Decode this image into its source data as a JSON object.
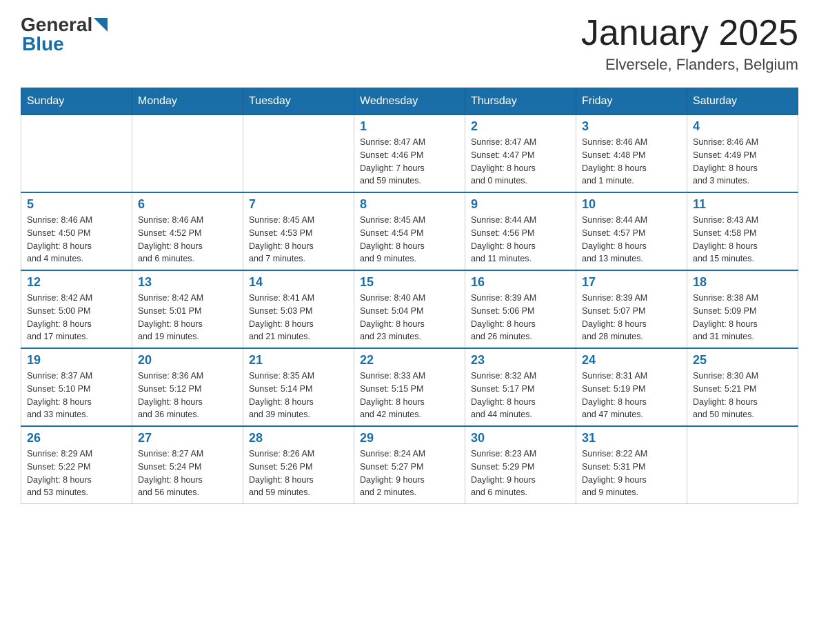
{
  "header": {
    "logo_general": "General",
    "logo_blue": "Blue",
    "month_title": "January 2025",
    "location": "Elversele, Flanders, Belgium"
  },
  "days_of_week": [
    "Sunday",
    "Monday",
    "Tuesday",
    "Wednesday",
    "Thursday",
    "Friday",
    "Saturday"
  ],
  "weeks": [
    {
      "days": [
        {
          "date": "",
          "info": ""
        },
        {
          "date": "",
          "info": ""
        },
        {
          "date": "",
          "info": ""
        },
        {
          "date": "1",
          "info": "Sunrise: 8:47 AM\nSunset: 4:46 PM\nDaylight: 7 hours\nand 59 minutes."
        },
        {
          "date": "2",
          "info": "Sunrise: 8:47 AM\nSunset: 4:47 PM\nDaylight: 8 hours\nand 0 minutes."
        },
        {
          "date": "3",
          "info": "Sunrise: 8:46 AM\nSunset: 4:48 PM\nDaylight: 8 hours\nand 1 minute."
        },
        {
          "date": "4",
          "info": "Sunrise: 8:46 AM\nSunset: 4:49 PM\nDaylight: 8 hours\nand 3 minutes."
        }
      ]
    },
    {
      "days": [
        {
          "date": "5",
          "info": "Sunrise: 8:46 AM\nSunset: 4:50 PM\nDaylight: 8 hours\nand 4 minutes."
        },
        {
          "date": "6",
          "info": "Sunrise: 8:46 AM\nSunset: 4:52 PM\nDaylight: 8 hours\nand 6 minutes."
        },
        {
          "date": "7",
          "info": "Sunrise: 8:45 AM\nSunset: 4:53 PM\nDaylight: 8 hours\nand 7 minutes."
        },
        {
          "date": "8",
          "info": "Sunrise: 8:45 AM\nSunset: 4:54 PM\nDaylight: 8 hours\nand 9 minutes."
        },
        {
          "date": "9",
          "info": "Sunrise: 8:44 AM\nSunset: 4:56 PM\nDaylight: 8 hours\nand 11 minutes."
        },
        {
          "date": "10",
          "info": "Sunrise: 8:44 AM\nSunset: 4:57 PM\nDaylight: 8 hours\nand 13 minutes."
        },
        {
          "date": "11",
          "info": "Sunrise: 8:43 AM\nSunset: 4:58 PM\nDaylight: 8 hours\nand 15 minutes."
        }
      ]
    },
    {
      "days": [
        {
          "date": "12",
          "info": "Sunrise: 8:42 AM\nSunset: 5:00 PM\nDaylight: 8 hours\nand 17 minutes."
        },
        {
          "date": "13",
          "info": "Sunrise: 8:42 AM\nSunset: 5:01 PM\nDaylight: 8 hours\nand 19 minutes."
        },
        {
          "date": "14",
          "info": "Sunrise: 8:41 AM\nSunset: 5:03 PM\nDaylight: 8 hours\nand 21 minutes."
        },
        {
          "date": "15",
          "info": "Sunrise: 8:40 AM\nSunset: 5:04 PM\nDaylight: 8 hours\nand 23 minutes."
        },
        {
          "date": "16",
          "info": "Sunrise: 8:39 AM\nSunset: 5:06 PM\nDaylight: 8 hours\nand 26 minutes."
        },
        {
          "date": "17",
          "info": "Sunrise: 8:39 AM\nSunset: 5:07 PM\nDaylight: 8 hours\nand 28 minutes."
        },
        {
          "date": "18",
          "info": "Sunrise: 8:38 AM\nSunset: 5:09 PM\nDaylight: 8 hours\nand 31 minutes."
        }
      ]
    },
    {
      "days": [
        {
          "date": "19",
          "info": "Sunrise: 8:37 AM\nSunset: 5:10 PM\nDaylight: 8 hours\nand 33 minutes."
        },
        {
          "date": "20",
          "info": "Sunrise: 8:36 AM\nSunset: 5:12 PM\nDaylight: 8 hours\nand 36 minutes."
        },
        {
          "date": "21",
          "info": "Sunrise: 8:35 AM\nSunset: 5:14 PM\nDaylight: 8 hours\nand 39 minutes."
        },
        {
          "date": "22",
          "info": "Sunrise: 8:33 AM\nSunset: 5:15 PM\nDaylight: 8 hours\nand 42 minutes."
        },
        {
          "date": "23",
          "info": "Sunrise: 8:32 AM\nSunset: 5:17 PM\nDaylight: 8 hours\nand 44 minutes."
        },
        {
          "date": "24",
          "info": "Sunrise: 8:31 AM\nSunset: 5:19 PM\nDaylight: 8 hours\nand 47 minutes."
        },
        {
          "date": "25",
          "info": "Sunrise: 8:30 AM\nSunset: 5:21 PM\nDaylight: 8 hours\nand 50 minutes."
        }
      ]
    },
    {
      "days": [
        {
          "date": "26",
          "info": "Sunrise: 8:29 AM\nSunset: 5:22 PM\nDaylight: 8 hours\nand 53 minutes."
        },
        {
          "date": "27",
          "info": "Sunrise: 8:27 AM\nSunset: 5:24 PM\nDaylight: 8 hours\nand 56 minutes."
        },
        {
          "date": "28",
          "info": "Sunrise: 8:26 AM\nSunset: 5:26 PM\nDaylight: 8 hours\nand 59 minutes."
        },
        {
          "date": "29",
          "info": "Sunrise: 8:24 AM\nSunset: 5:27 PM\nDaylight: 9 hours\nand 2 minutes."
        },
        {
          "date": "30",
          "info": "Sunrise: 8:23 AM\nSunset: 5:29 PM\nDaylight: 9 hours\nand 6 minutes."
        },
        {
          "date": "31",
          "info": "Sunrise: 8:22 AM\nSunset: 5:31 PM\nDaylight: 9 hours\nand 9 minutes."
        },
        {
          "date": "",
          "info": ""
        }
      ]
    }
  ]
}
